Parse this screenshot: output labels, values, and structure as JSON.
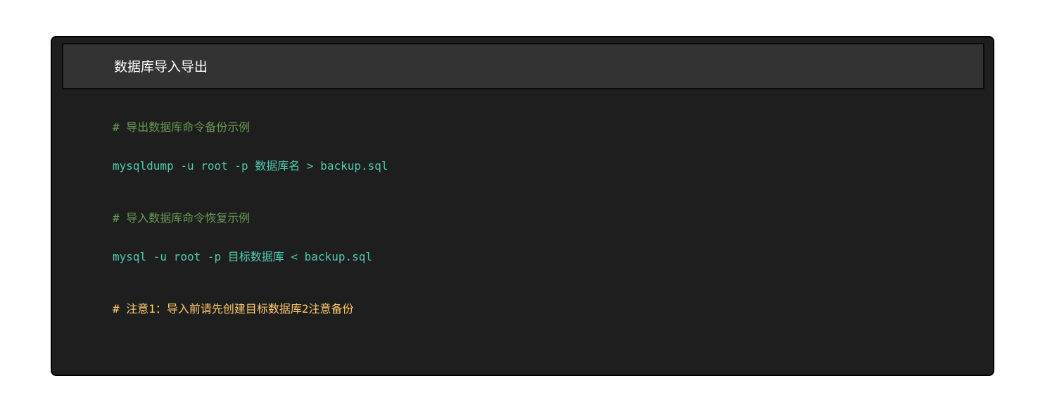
{
  "panel": {
    "title": "数据库导入导出"
  },
  "code_lines": [
    {
      "kind": "comment",
      "text": "# 导出数据库命令备份示例"
    },
    {
      "kind": "command",
      "text": "mysqldump -u root -p 数据库名 > backup.sql"
    },
    {
      "kind": "comment",
      "text": "# 导入数据库命令恢复示例"
    },
    {
      "kind": "command",
      "text": "mysql -u root -p 目标数据库 < backup.sql"
    },
    {
      "kind": "comment-highlight",
      "text": "# 注意1：导入前请先创建目标数据库2注意备份"
    }
  ],
  "colors": {
    "panel_background": "#1e1e1e",
    "header_background": "#333333",
    "comment": "#6a9955",
    "command": "#4ec9b0",
    "highlight_comment": "#ffcb6b"
  }
}
